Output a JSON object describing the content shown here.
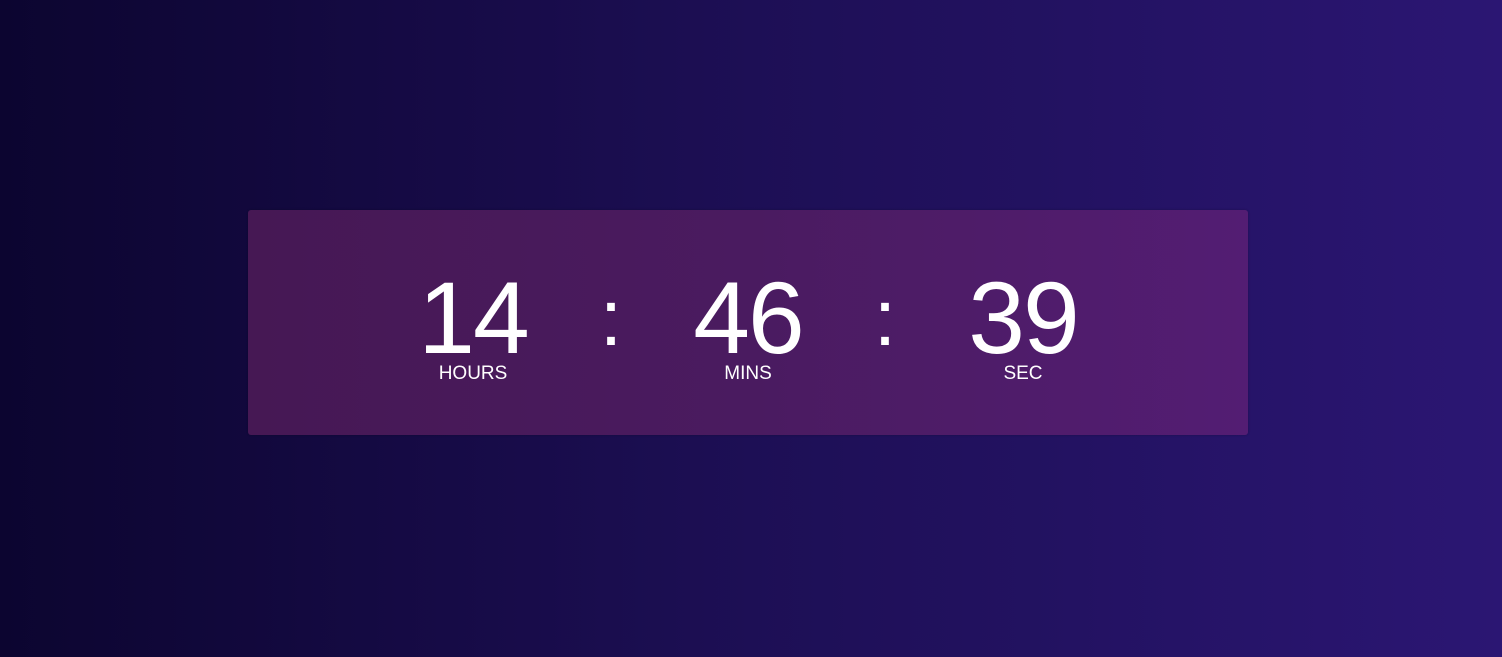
{
  "countdown": {
    "hours": {
      "value": "14",
      "label": "HOURS"
    },
    "minutes": {
      "value": "46",
      "label": "MINS"
    },
    "seconds": {
      "value": "39",
      "label": "SEC"
    },
    "separator": ":"
  },
  "colors": {
    "background_start": "#0c0530",
    "background_end": "#2b1673",
    "card_start": "#461854",
    "card_end": "#531d73",
    "text": "#ffffff"
  }
}
